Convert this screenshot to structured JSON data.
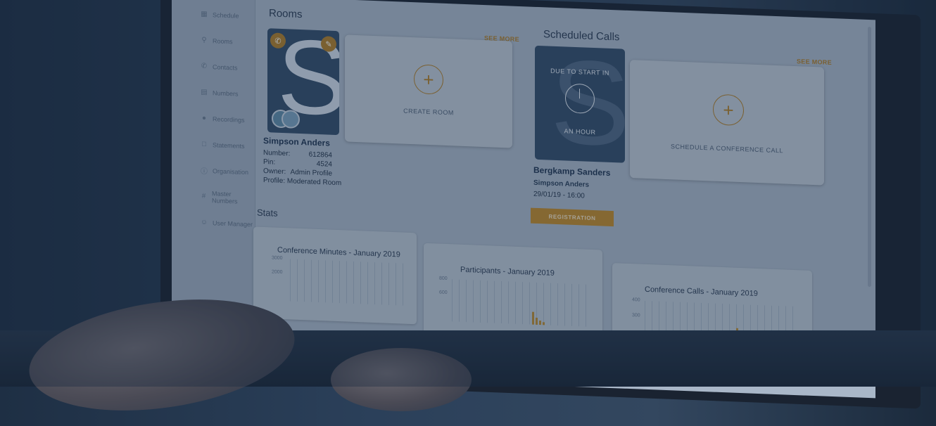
{
  "sidebar": {
    "items": [
      {
        "icon": "calendar-icon",
        "label": "Schedule"
      },
      {
        "icon": "location-pin-icon",
        "label": "Rooms"
      },
      {
        "icon": "phone-icon",
        "label": "Contacts"
      },
      {
        "icon": "document-icon",
        "label": "Numbers"
      },
      {
        "icon": "microphone-icon",
        "label": "Recordings"
      },
      {
        "icon": "file-icon",
        "label": "Statements"
      },
      {
        "icon": "info-icon",
        "label": "Organisation"
      },
      {
        "icon": "hash-icon",
        "label": "Master Numbers"
      },
      {
        "icon": "users-icon",
        "label": "User Manager"
      }
    ]
  },
  "rooms": {
    "heading": "Rooms",
    "see_more": "SEE MORE",
    "room": {
      "thumb_letter": "S",
      "name": "Simpson Anders",
      "fields": [
        {
          "label": "Number:",
          "value": "612864"
        },
        {
          "label": "Pin:",
          "value": "4524"
        },
        {
          "label": "Owner:",
          "value": "Admin Profile"
        }
      ],
      "profile": "Profile: Moderated Room"
    },
    "create_label": "CREATE ROOM"
  },
  "calls": {
    "heading": "Scheduled Calls",
    "see_more": "SEE MORE",
    "call": {
      "thumb_letter": "S",
      "due_line1": "DUE TO START IN",
      "due_line2": "AN HOUR",
      "title": "Bergkamp Sanders",
      "host": "Simpson Anders",
      "datetime": "29/01/19 - 16:00",
      "button": "REGISTRATION"
    },
    "schedule_label": "SCHEDULE A CONFERENCE CALL"
  },
  "stats": {
    "heading": "Stats",
    "cards": [
      {
        "title": "Conference Minutes - January 2019",
        "ticks": [
          "3000",
          "2000"
        ]
      },
      {
        "title": "Participants - January 2019",
        "ticks": [
          "800",
          "600"
        ]
      },
      {
        "title": "Conference Calls - January 2019",
        "ticks": [
          "400",
          "300"
        ]
      }
    ]
  },
  "colors": {
    "accent": "#c08a2c",
    "screen_bg": "#a9b7c8",
    "overlay": "#1e3350"
  }
}
